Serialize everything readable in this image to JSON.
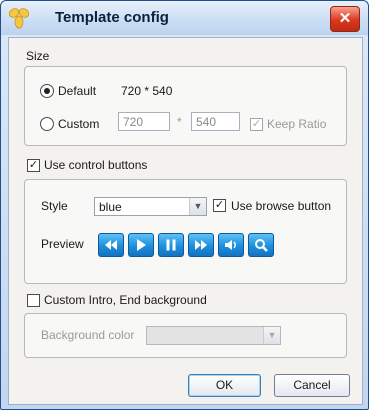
{
  "window": {
    "title": "Template config",
    "close_label": "✕"
  },
  "size_group": {
    "label": "Size",
    "default_label": "Default",
    "default_value": "720 * 540",
    "custom_label": "Custom",
    "custom_width": "720",
    "separator": "*",
    "custom_height": "540",
    "keep_ratio_label": "Keep Ratio"
  },
  "control_buttons": {
    "label": "Use control buttons",
    "style_label": "Style",
    "style_value": "blue",
    "use_browse_label": "Use browse button",
    "preview_label": "Preview",
    "preview_icons": [
      "rewind-icon",
      "play-icon",
      "pause-icon",
      "fast-forward-icon",
      "volume-icon",
      "zoom-icon"
    ]
  },
  "background": {
    "label": "Custom Intro, End background",
    "color_label": "Background color"
  },
  "footer": {
    "ok_label": "OK",
    "cancel_label": "Cancel"
  },
  "colors": {
    "titlebar": "#cfe0f5",
    "accent_blue": "#1c8fdd",
    "close_red": "#d9381e"
  }
}
